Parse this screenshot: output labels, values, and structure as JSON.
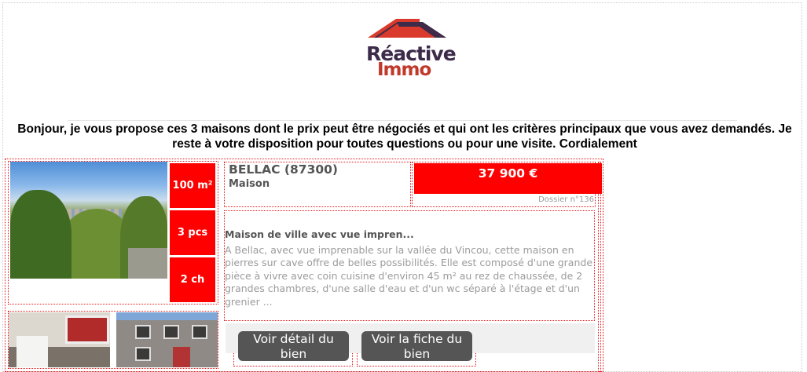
{
  "brand": {
    "name_line1": "Réactive",
    "name_line2": "Immo",
    "roof_color": "#d93a2b",
    "roof_dark": "#3d2b4a"
  },
  "intro_text": "Bonjour, je vous propose ces 3 maisons dont le prix peut être négociés et qui ont les critères principaux que vous avez demandés. Je reste à votre disposition pour toutes questions ou pour une visite. Cordialement",
  "listing": {
    "stats": {
      "area": "100 m²",
      "rooms": "3 pcs",
      "bedrooms": "2 ch"
    },
    "city": "BELLAC (87300)",
    "type": "Maison",
    "price": "37 900 €",
    "dossier": "Dossier n°136",
    "title": "Maison de ville avec vue impren...",
    "description": "A Bellac, avec vue imprenable sur la vallée du Vincou, cette maison en pierres sur cave offre de belles possibilités. Elle est composé d'une grande pièce à vivre avec coin cuisine d'environ 45 m² au rez de chaussée, de 2 grandes chambres, d'une salle d'eau et d'un wc séparé à l'étage et d'un grenier ...",
    "buttons": {
      "detail_line1": "Voir détail du",
      "detail_line2": "bien",
      "sheet_line1": "Voir la fiche du",
      "sheet_line2": "bien"
    },
    "accent_color": "#ff0000"
  }
}
